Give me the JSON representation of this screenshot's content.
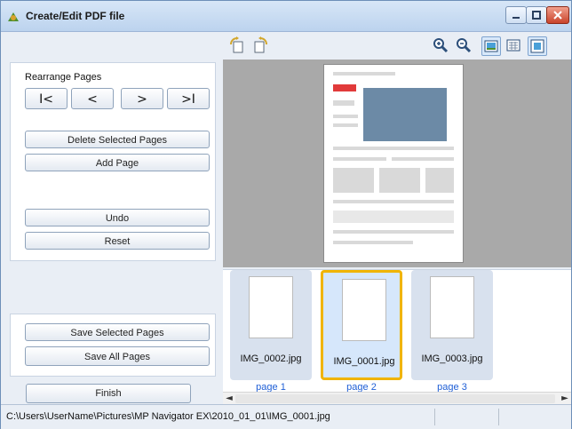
{
  "window": {
    "title": "Create/Edit PDF file",
    "controls": [
      "minimize",
      "maximize",
      "close"
    ]
  },
  "left_panel": {
    "rearrange_label": "Rearrange Pages",
    "nav": {
      "first": "I<",
      "prev": "<",
      "next": ">",
      "last": ">I"
    },
    "buttons": {
      "delete_selected": "Delete Selected Pages",
      "add_page": "Add Page",
      "undo": "Undo",
      "reset": "Reset",
      "save_selected": "Save Selected Pages",
      "save_all": "Save All Pages",
      "finish": "Finish"
    }
  },
  "toolbar": {
    "icons": [
      "rotate-left-icon",
      "rotate-right-icon",
      "zoom-in-icon",
      "zoom-out-icon",
      "view-preview-icon",
      "view-thumbnails-icon",
      "view-full-icon"
    ]
  },
  "thumbnails": [
    {
      "file": "IMG_0002.jpg",
      "label": "page 1",
      "selected": false
    },
    {
      "file": "IMG_0001.jpg",
      "label": "page 2",
      "selected": true
    },
    {
      "file": "IMG_0003.jpg",
      "label": "page 3",
      "selected": false
    }
  ],
  "status_bar": {
    "path": "C:\\Users\\UserName\\Pictures\\MP Navigator EX\\2010_01_01\\IMG_0001.jpg"
  },
  "colors": {
    "selected_border": "#f0b400",
    "page_label": "#1f5fd6",
    "preview_bg": "#a9a9a9"
  }
}
